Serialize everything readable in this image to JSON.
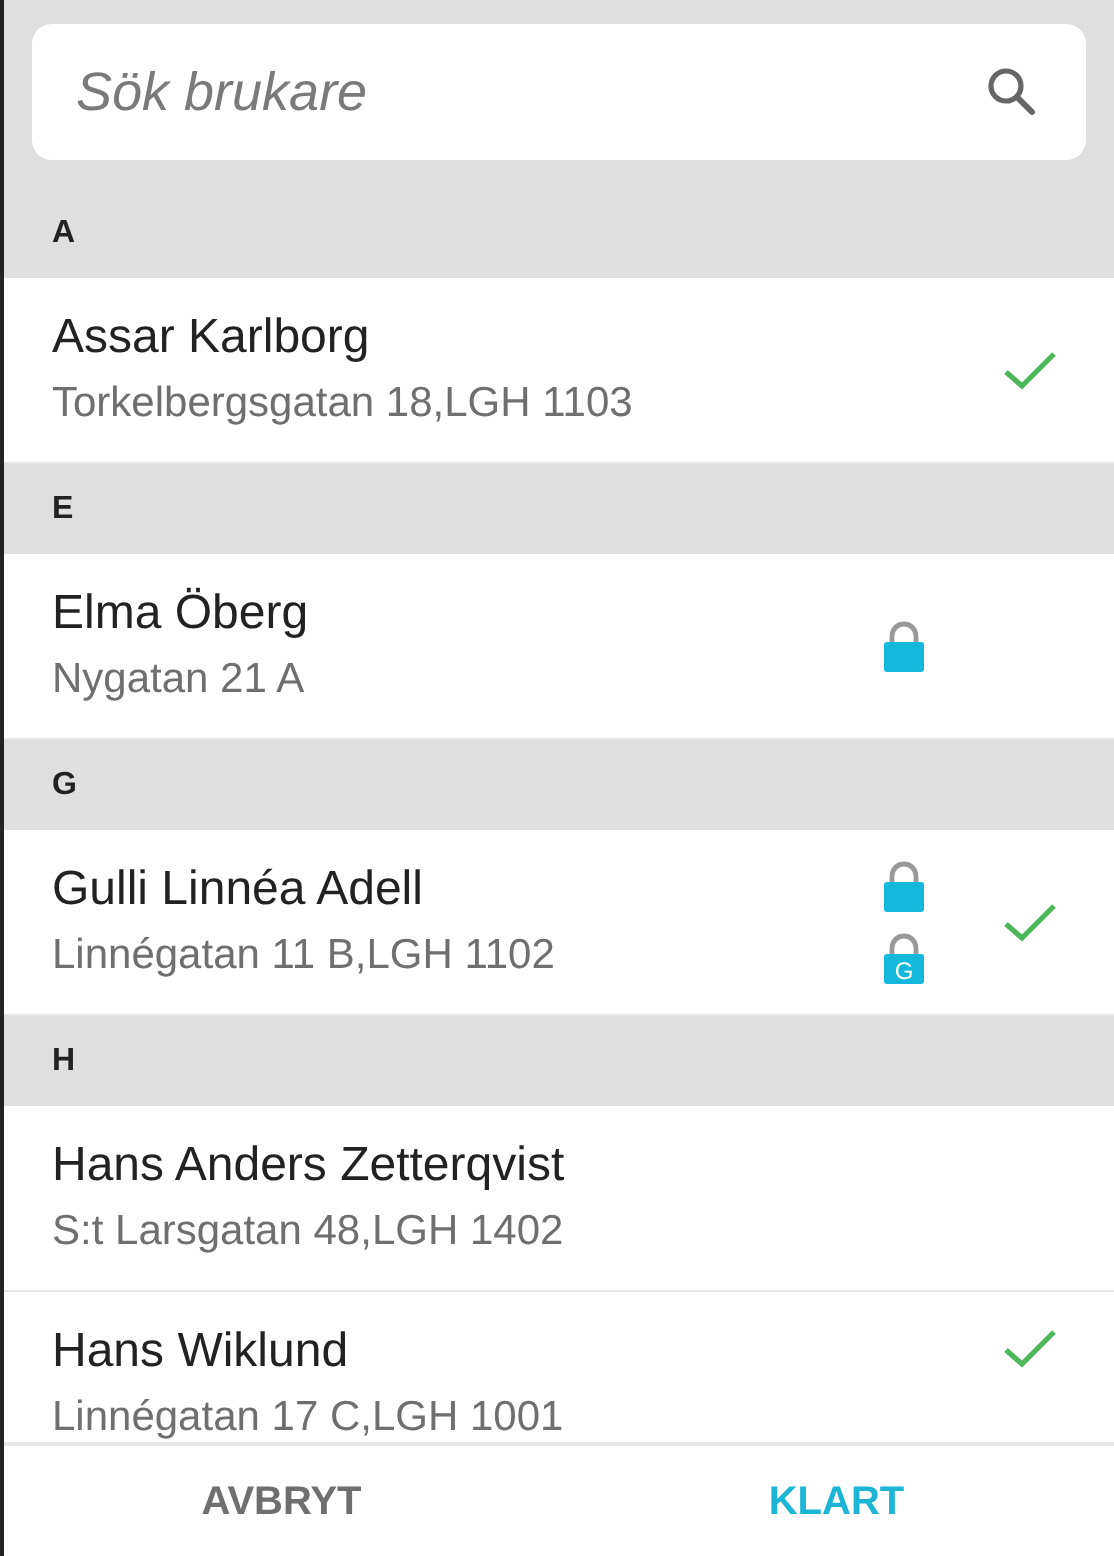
{
  "search": {
    "placeholder": "Sök brukare"
  },
  "sections": [
    {
      "letter": "A",
      "people": [
        {
          "name": "Assar Karlborg",
          "address": "Torkelbergsgatan 18,LGH 1103",
          "checked": true
        }
      ]
    },
    {
      "letter": "E",
      "people": [
        {
          "name": "Elma Öberg",
          "address": "Nygatan 21 A",
          "locks": [
            {
              "kind": "plain"
            }
          ],
          "checked": false
        }
      ]
    },
    {
      "letter": "G",
      "people": [
        {
          "name": "Gulli Linnéa Adell",
          "address": "Linnégatan 11 B,LGH 1102",
          "locks": [
            {
              "kind": "plain"
            },
            {
              "kind": "lettered",
              "label": "G"
            }
          ],
          "checked": true
        }
      ]
    },
    {
      "letter": "H",
      "people": [
        {
          "name": "Hans Anders Zetterqvist",
          "address": "S:t Larsgatan 48,LGH 1402",
          "checked": false
        },
        {
          "name": "Hans Wiklund",
          "address": "Linnégatan 17 C,LGH 1001",
          "checked": true
        }
      ]
    }
  ],
  "buttons": [
    {
      "label": "AVBRYT",
      "kind": "cancel"
    },
    {
      "label": "KLART",
      "kind": "confirm"
    }
  ]
}
